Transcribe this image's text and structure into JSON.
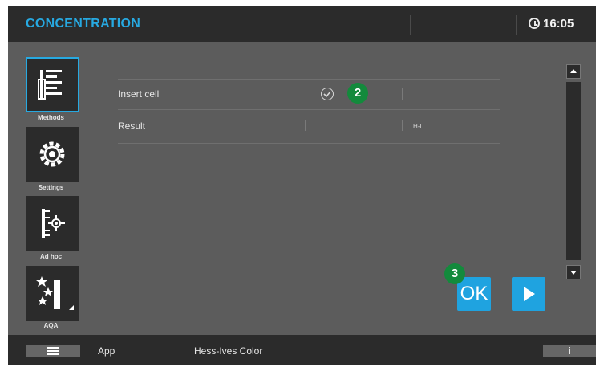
{
  "header": {
    "title": "CONCENTRATION",
    "time": "16:05"
  },
  "sidebar": {
    "items": [
      {
        "label": "Methods",
        "icon": "methods-icon",
        "active": true
      },
      {
        "label": "Settings",
        "icon": "settings-gear-icon",
        "active": false
      },
      {
        "label": "Ad hoc",
        "icon": "ad-hoc-icon",
        "active": false
      },
      {
        "label": "AQA",
        "icon": "aqa-icon",
        "active": false
      }
    ]
  },
  "table": {
    "rows": [
      {
        "label": "Insert cell",
        "status_icon": "check-circle-icon"
      },
      {
        "label": "Result",
        "value": "H-I"
      }
    ]
  },
  "badges": {
    "step2": "2",
    "step3": "3"
  },
  "buttons": {
    "ok": "OK",
    "info": "i"
  },
  "footer": {
    "app_label": "App",
    "method_name": "Hess-Ives Color"
  },
  "colors": {
    "accent": "#27a9e1",
    "button_blue": "#1fa3e0",
    "badge_green": "#138a3c",
    "background": "#5c5c5c",
    "bar": "#2b2b2b"
  }
}
